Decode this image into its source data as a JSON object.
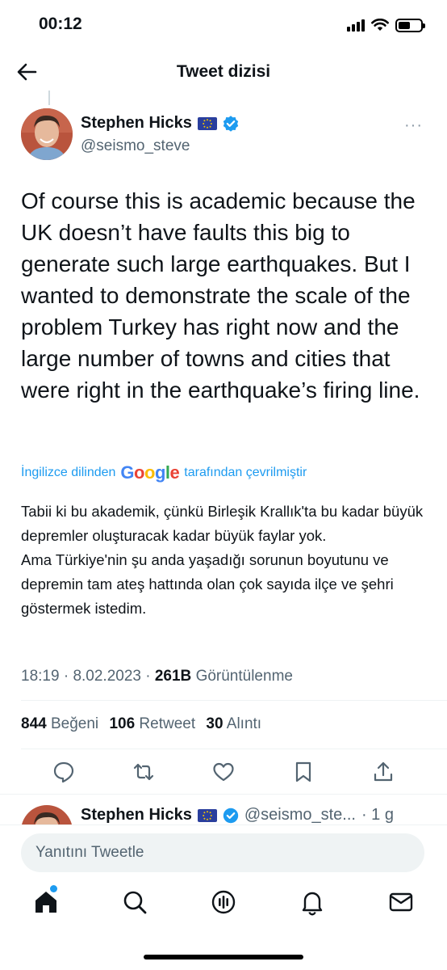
{
  "status_bar": {
    "time": "00:12"
  },
  "header": {
    "title": "Tweet dizisi"
  },
  "tweet": {
    "author_name": "Stephen Hicks",
    "author_handle": "@seismo_steve",
    "more": "···",
    "text": "Of course this is academic because the UK doesn’t have faults this big to generate such large earthquakes. But I wanted to demonstrate the scale of the problem Turkey has right now and the large number of towns and cities that were right in the earthquake’s firing line.",
    "translation_prefix": "İngilizce dilinden",
    "translation_provider": "Google",
    "translation_suffix": "tarafından çevrilmiştir",
    "translation": "Tabii ki bu akademik, çünkü Birleşik Krallık'ta bu kadar büyük depremler oluşturacak kadar büyük faylar yok.\nAma Türkiye'nin şu anda yaşadığı sorunun boyutunu ve depremin tam ateş hattında olan çok sayıda ilçe ve şehri göstermek istedim.",
    "time": "18:19",
    "date": "8.02.2023",
    "views_count": "261B",
    "views_label": "Görüntülenme",
    "likes_count": "844",
    "likes_label": "Beğeni",
    "retweets_count": "106",
    "retweets_label": "Retweet",
    "quotes_count": "30",
    "quotes_label": "Alıntı"
  },
  "reply": {
    "author_name": "Stephen Hicks",
    "author_handle": "@seismo_ste...",
    "age": "· 1 g",
    "more": "···"
  },
  "compose": {
    "placeholder": "Yanıtını Tweetle"
  },
  "icons": {
    "back": "arrow-left-icon",
    "reply": "comment-icon",
    "retweet": "retweet-icon",
    "like": "heart-icon",
    "bookmark": "bookmark-icon",
    "share": "share-icon",
    "home": "home-icon",
    "search": "search-icon",
    "spaces": "spaces-icon",
    "notifications": "bell-icon",
    "messages": "mail-icon"
  },
  "colors": {
    "accent": "#1d9bf0",
    "text": "#0f1419",
    "muted": "#536471"
  }
}
